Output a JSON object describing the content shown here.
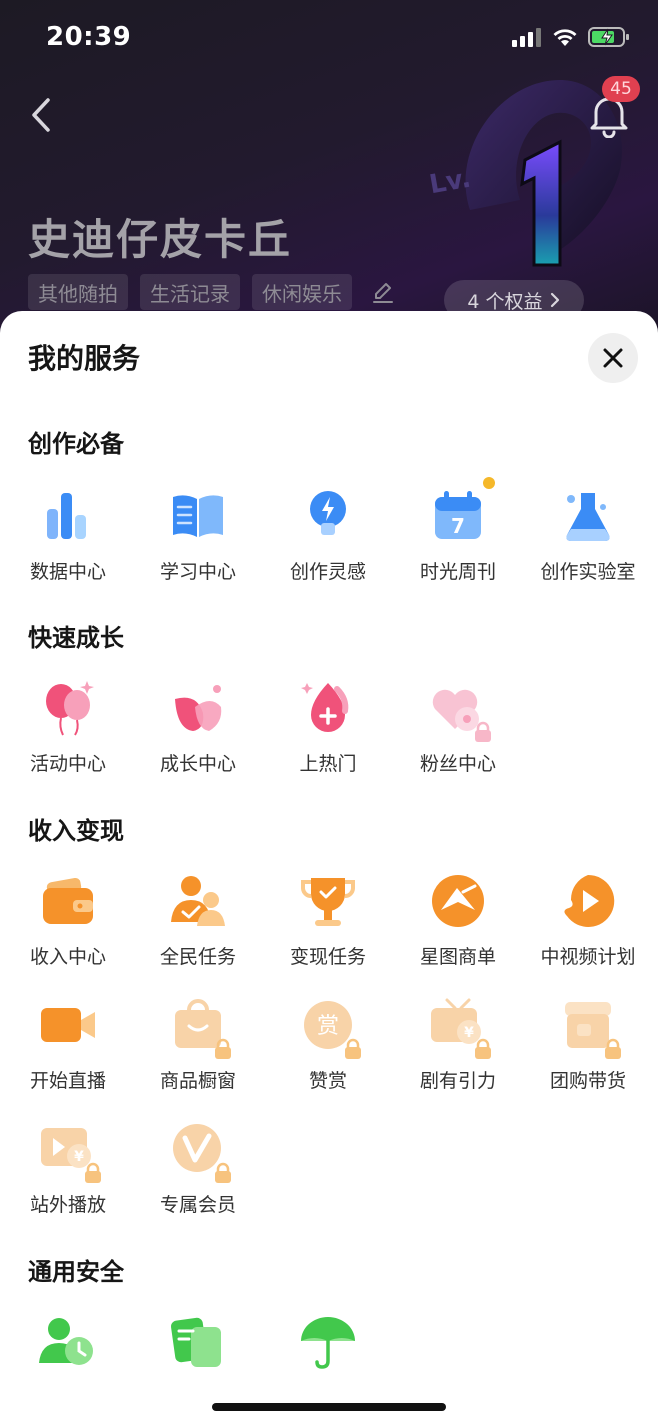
{
  "status_bar": {
    "time": "20:39"
  },
  "header": {
    "notification_count": "45",
    "username": "史迪仔皮卡丘",
    "level_badge": "Lv.1",
    "tags": [
      "其他随拍",
      "生活记录",
      "休闲娱乐"
    ],
    "rights_label": "4 个权益"
  },
  "sheet": {
    "title": "我的服务",
    "sections": [
      {
        "title": "创作必备",
        "items": [
          "数据中心",
          "学习中心",
          "创作灵感",
          "时光周刊",
          "创作实验室"
        ]
      },
      {
        "title": "快速成长",
        "items": [
          "活动中心",
          "成长中心",
          "上热门",
          "粉丝中心"
        ]
      },
      {
        "title": "收入变现",
        "items": [
          "收入中心",
          "全民任务",
          "变现任务",
          "星图商单",
          "中视频计划",
          "开始直播",
          "商品橱窗",
          "赞赏",
          "剧有引力",
          "团购带货",
          "站外播放",
          "专属会员"
        ]
      },
      {
        "title": "通用安全",
        "items": []
      }
    ],
    "calendar_day": "7",
    "reward_char": "赏",
    "currency_char": "¥"
  },
  "colors": {
    "accent_blue": "#3b8cf5",
    "accent_pink": "#f0527a",
    "accent_orange": "#f5922a",
    "accent_green": "#42c84c"
  }
}
